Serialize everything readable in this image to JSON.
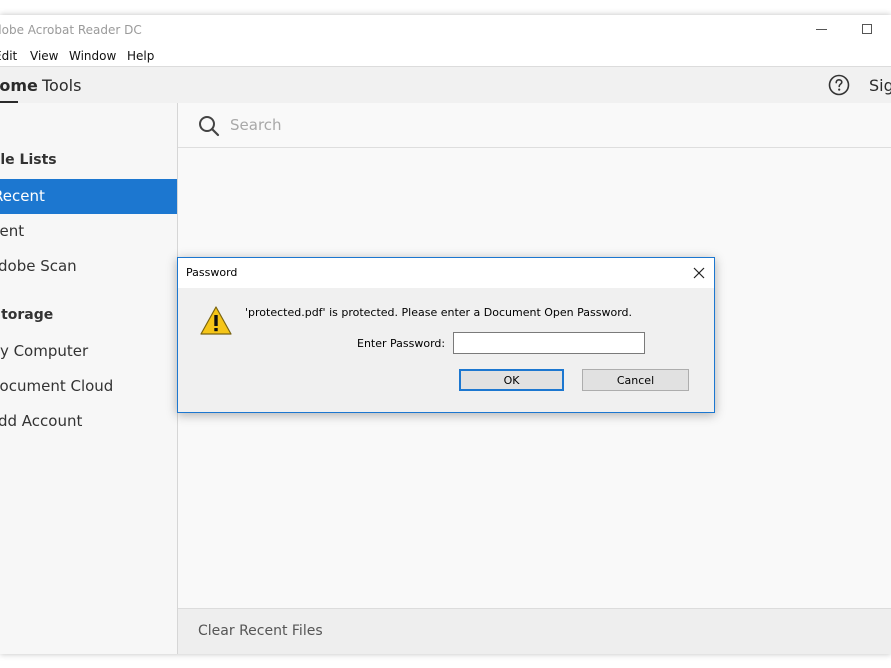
{
  "window": {
    "title": "Adobe Acrobat Reader DC"
  },
  "menu": {
    "items": [
      "Edit",
      "View",
      "Window",
      "Help"
    ]
  },
  "topnav": {
    "home_label": "Home",
    "tools_label": "Tools",
    "sign_label": "Sign"
  },
  "sidebar": {
    "file_lists_header": "File Lists",
    "file_items": [
      "Recent",
      "Sent",
      "Adobe Scan"
    ],
    "selected_item": "Recent",
    "storage_header": "Storage",
    "storage_items": [
      "My Computer",
      "Document Cloud",
      "Add Account"
    ]
  },
  "search": {
    "placeholder": "Search"
  },
  "footer": {
    "clear_recent_label": "Clear Recent Files"
  },
  "dialog": {
    "title": "Password",
    "message": "'protected.pdf' is protected. Please enter a Document Open Password.",
    "password_label": "Enter Password:",
    "password_value": "",
    "ok_label": "OK",
    "cancel_label": "Cancel"
  },
  "colors": {
    "accent": "#1c77d0",
    "warning": "#f5c518"
  },
  "icons": {
    "help": "help-icon",
    "search": "search-icon",
    "close": "close-icon",
    "warning": "warning-icon",
    "minimize": "minimize-icon",
    "maximize": "maximize-icon"
  }
}
